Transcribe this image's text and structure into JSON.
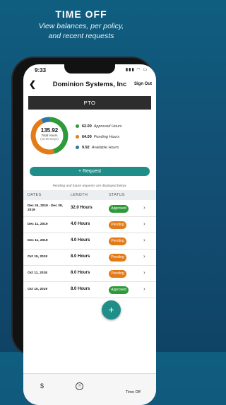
{
  "hero": {
    "title": "TIME OFF",
    "subtitle_line1": "View balances, per policy,",
    "subtitle_line2": "and recent requests"
  },
  "status_bar": {
    "time": "9:33"
  },
  "nav": {
    "title": "Dominion Systems, Inc",
    "sign_out": "Sign Out",
    "back_icon": "chevron-left-icon"
  },
  "section": {
    "title": "PTO"
  },
  "donut": {
    "total_value": "135.92",
    "total_label": "Total Hours",
    "total_sub": "(16.00 Days)",
    "segments": [
      {
        "label": "Approved Hours",
        "value": 62.0,
        "color": "#2e9a3a"
      },
      {
        "label": "Pending Hours",
        "value": 64.0,
        "color": "#e37b19"
      },
      {
        "label": "Available Hours",
        "value": 9.92,
        "color": "#2a78a8"
      }
    ]
  },
  "legend": [
    {
      "value": "62.00",
      "label": "Approved Hours",
      "color": "#2e9a3a"
    },
    {
      "value": "64.00",
      "label": "Pending Hours",
      "color": "#e37b19"
    },
    {
      "value": "9.92",
      "label": "Available Hours",
      "color": "#2a78a8"
    }
  ],
  "request_button": {
    "icon": "+",
    "label": "Request"
  },
  "note": "Pending and future requests are displayed below.",
  "table": {
    "headers": {
      "dates": "DATES",
      "length": "LENGTH",
      "status": "STATUS"
    },
    "rows": [
      {
        "dates": "Dec 24, 2019 - Dec 28, 2019",
        "length": "32.0 Hours",
        "status": "Approved"
      },
      {
        "dates": "Dec 11, 2019",
        "length": "4.0 Hours",
        "status": "Pending"
      },
      {
        "dates": "Dec 11, 2019",
        "length": "4.0 Hours",
        "status": "Pending"
      },
      {
        "dates": "Oct 15, 2019",
        "length": "8.0 Hours",
        "status": "Pending"
      },
      {
        "dates": "Oct 11, 2018",
        "length": "8.0 Hours",
        "status": "Pending"
      },
      {
        "dates": "Oct 10, 2019",
        "length": "8.0 Hours",
        "status": "Approved"
      }
    ]
  },
  "tabbar": {
    "dollar_icon": "$",
    "time_off_label": "Time Off",
    "fab_icon": "+"
  }
}
